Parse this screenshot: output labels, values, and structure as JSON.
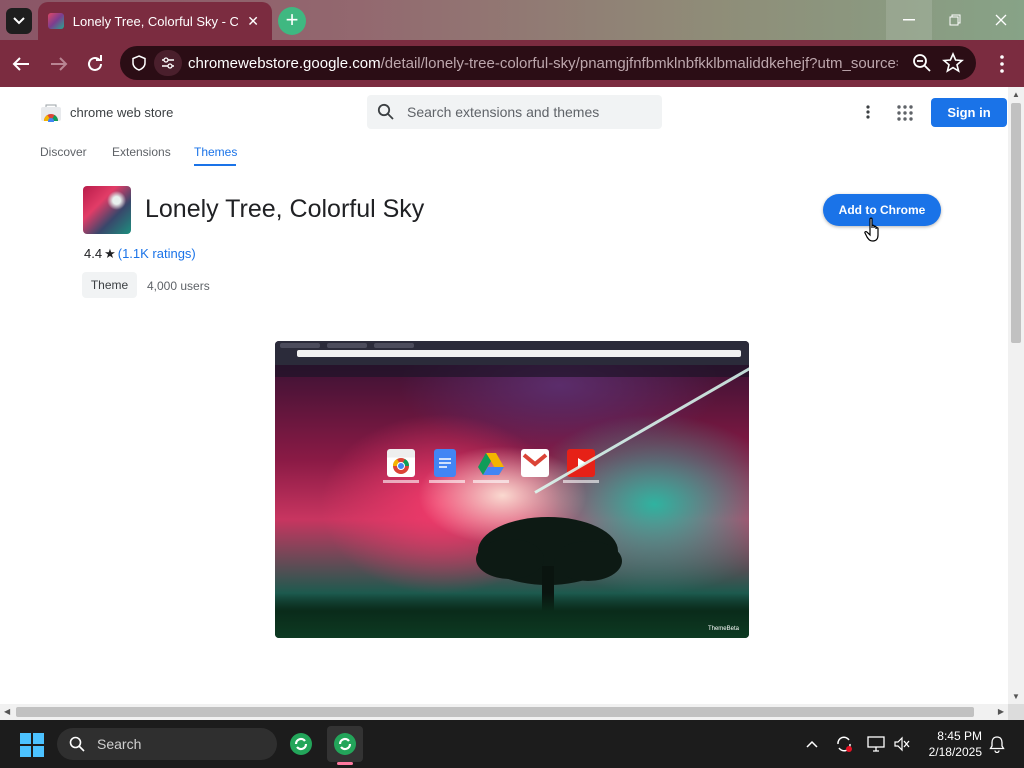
{
  "browser": {
    "tab_title": "Lonely Tree, Colorful Sky - Chrome Web Store",
    "url_host": "chromewebstore.google.com",
    "url_path": "/detail/lonely-tree-colorful-sky/pnamgjfnfbmklnbfkklbmaliddkehejf?utm_source=ex..."
  },
  "header": {
    "store_name": "chrome web store",
    "search_placeholder": "Search extensions and themes",
    "signin_label": "Sign in"
  },
  "nav_tabs": [
    {
      "label": "Discover",
      "active": false
    },
    {
      "label": "Extensions",
      "active": false
    },
    {
      "label": "Themes",
      "active": true
    }
  ],
  "item": {
    "title": "Lonely Tree, Colorful Sky",
    "rating": "4.4",
    "ratings_count": "(1.1K ratings)",
    "category": "Theme",
    "users": "4,000 users",
    "add_button_label": "Add to Chrome"
  },
  "taskbar": {
    "search_label": "Search",
    "time": "8:45 PM",
    "date": "2/18/2025"
  },
  "colors": {
    "accent": "#1a73e8",
    "tab_bg": "#7b2c40"
  }
}
